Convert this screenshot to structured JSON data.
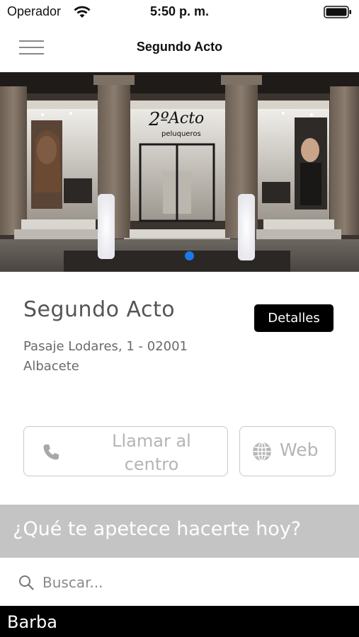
{
  "status_bar": {
    "carrier": "Operador",
    "time": "5:50 p. m."
  },
  "nav": {
    "title": "Segundo Acto",
    "menu_icon": "hamburger-menu-icon"
  },
  "hero": {
    "sign_text": "2º Acto",
    "sign_subtext": "peluqueros",
    "slide_index": 1,
    "slide_count": 1
  },
  "venue": {
    "name": "Segundo Acto",
    "address_line1": "Pasaje Lodares, 1 - 02001",
    "address_line2": "Albacete",
    "details_label": "Detalles"
  },
  "actions": {
    "call_label": "Llamar al centro",
    "call_icon": "phone-icon",
    "web_label": "Web",
    "web_icon": "globe-icon"
  },
  "prompt": {
    "question": "¿Qué te apetece hacerte hoy?"
  },
  "search": {
    "placeholder": "Buscar...",
    "value": "",
    "icon": "search-icon"
  },
  "categories": [
    {
      "label": "Barba"
    }
  ],
  "colors": {
    "accent_dot": "#1e78e6",
    "details_bg": "#000000",
    "question_band": "#c4c4c4",
    "category_bar": "#000000"
  }
}
